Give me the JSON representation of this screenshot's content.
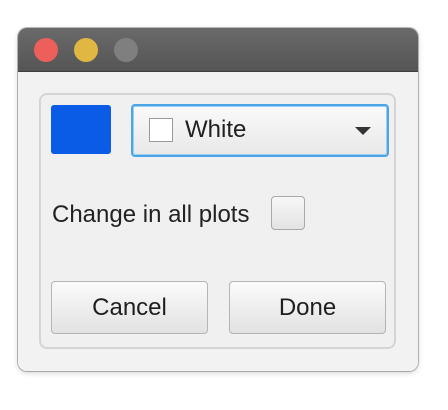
{
  "window": {
    "traffic_lights": {
      "close_color": "#ec5f5a",
      "minimize_color": "#e1b743",
      "maximize_color": "#7f7f7f"
    }
  },
  "color_picker": {
    "swatch_color": "#0a5ce6",
    "selected_color": "White",
    "selected_color_swatch": "#ffffff",
    "dropdown_icon": "triangle-down-icon"
  },
  "change_all": {
    "label": "Change in all plots",
    "checked": false
  },
  "buttons": {
    "cancel_label": "Cancel",
    "done_label": "Done"
  }
}
